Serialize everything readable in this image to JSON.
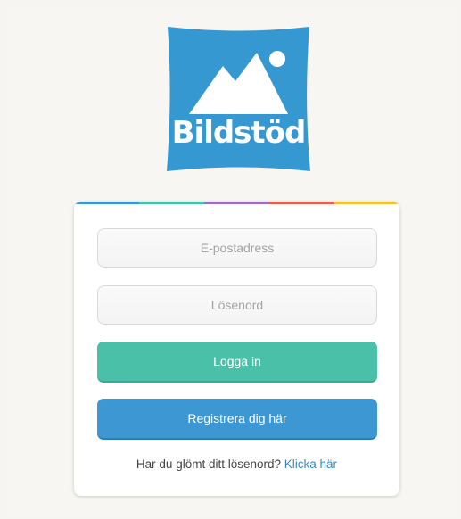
{
  "brand": {
    "name": "Bildstöd",
    "logo_icon": "mountain-image-icon",
    "logo_color": "#3598d0"
  },
  "stripe_colors": [
    "#3d97d3",
    "#4bc0a9",
    "#9b6fc0",
    "#e2624f",
    "#f2c230"
  ],
  "login": {
    "email_placeholder": "E-postadress",
    "password_placeholder": "Lösenord",
    "login_button": "Logga in",
    "register_button": "Registrera dig här",
    "forgot_text": "Har du glömt ditt lösenord?",
    "forgot_link": "Klicka här"
  }
}
